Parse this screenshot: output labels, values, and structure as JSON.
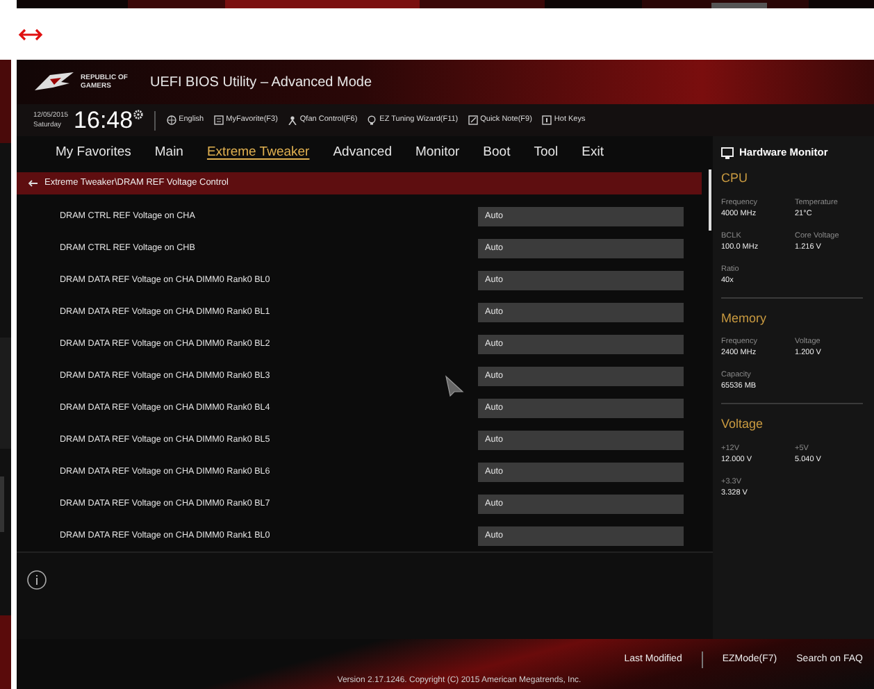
{
  "header": {
    "logo_text": "REPUBLIC OF GAMERS",
    "title": "UEFI BIOS Utility – Advanced Mode"
  },
  "info_bar": {
    "date": "12/05/2015",
    "day": "Saturday",
    "time": "16:48",
    "items": [
      "English",
      "MyFavorite(F3)",
      "Qfan Control(F6)",
      "EZ Tuning Wizard(F11)",
      "Quick Note(F9)",
      "Hot Keys"
    ]
  },
  "tabs": [
    {
      "label": "My Favorites",
      "selected": false
    },
    {
      "label": "Main",
      "selected": false
    },
    {
      "label": "Extreme Tweaker",
      "selected": true
    },
    {
      "label": "Advanced",
      "selected": false
    },
    {
      "label": "Monitor",
      "selected": false
    },
    {
      "label": "Boot",
      "selected": false
    },
    {
      "label": "Tool",
      "selected": false
    },
    {
      "label": "Exit",
      "selected": false
    }
  ],
  "breadcrumb": "Extreme Tweaker\\DRAM REF Voltage Control",
  "settings": [
    {
      "label": "DRAM CTRL REF Voltage on CHA",
      "value": "Auto"
    },
    {
      "label": "DRAM CTRL REF Voltage on CHB",
      "value": "Auto"
    },
    {
      "label": "DRAM DATA REF Voltage on CHA DIMM0 Rank0 BL0",
      "value": "Auto"
    },
    {
      "label": "DRAM DATA REF Voltage on CHA DIMM0 Rank0 BL1",
      "value": "Auto"
    },
    {
      "label": "DRAM DATA REF Voltage on CHA DIMM0 Rank0 BL2",
      "value": "Auto"
    },
    {
      "label": "DRAM DATA REF Voltage on CHA DIMM0 Rank0 BL3",
      "value": "Auto"
    },
    {
      "label": "DRAM DATA REF Voltage on CHA DIMM0 Rank0 BL4",
      "value": "Auto"
    },
    {
      "label": "DRAM DATA REF Voltage on CHA DIMM0 Rank0 BL5",
      "value": "Auto"
    },
    {
      "label": "DRAM DATA REF Voltage on CHA DIMM0 Rank0 BL6",
      "value": "Auto"
    },
    {
      "label": "DRAM DATA REF Voltage on CHA DIMM0 Rank0 BL7",
      "value": "Auto"
    },
    {
      "label": "DRAM DATA REF Voltage on CHA DIMM0 Rank1 BL0",
      "value": "Auto"
    }
  ],
  "hardware_monitor": {
    "title": "Hardware Monitor",
    "sections": [
      {
        "title": "CPU",
        "readings": [
          {
            "label": "Frequency",
            "value": "4000 MHz"
          },
          {
            "label": "Temperature",
            "value": "21°C"
          },
          {
            "label": "BCLK",
            "value": "100.0 MHz"
          },
          {
            "label": "Core Voltage",
            "value": "1.216 V"
          },
          {
            "label": "Ratio",
            "value": "40x"
          }
        ]
      },
      {
        "title": "Memory",
        "readings": [
          {
            "label": "Frequency",
            "value": "2400 MHz"
          },
          {
            "label": "Voltage",
            "value": "1.200 V"
          },
          {
            "label": "Capacity",
            "value": "65536 MB"
          }
        ]
      },
      {
        "title": "Voltage",
        "readings": [
          {
            "label": "+12V",
            "value": "12.000 V"
          },
          {
            "label": "+5V",
            "value": "5.040 V"
          },
          {
            "label": "+3.3V",
            "value": "3.328 V"
          }
        ]
      }
    ]
  },
  "footer": {
    "actions": [
      "Last Modified",
      "EZMode(F7)",
      "Search on FAQ"
    ],
    "version": "Version 2.17.1246. Copyright (C) 2015 American Megatrends, Inc."
  }
}
